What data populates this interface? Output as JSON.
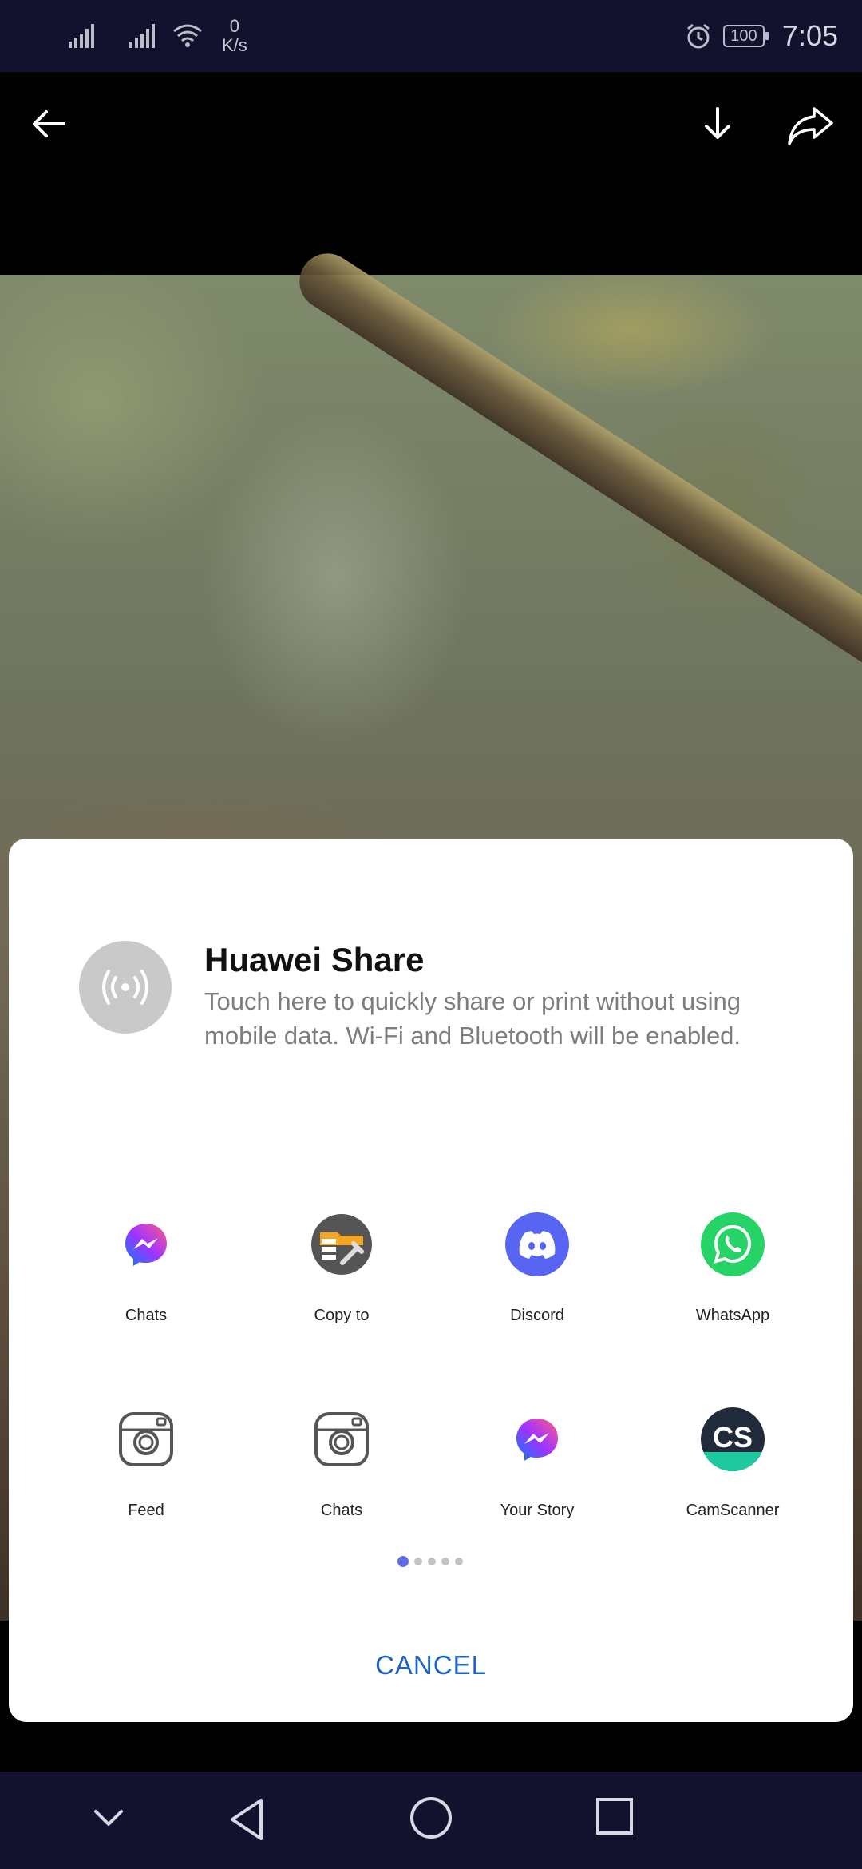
{
  "status_bar": {
    "speed_value": "0",
    "speed_unit": "K/s",
    "battery": "100",
    "time": "7:05"
  },
  "share_sheet": {
    "huawei_share": {
      "title": "Huawei Share",
      "description": "Touch here to quickly share or print without using mobile data. Wi-Fi and Bluetooth will be enabled."
    },
    "apps": [
      {
        "label": "Chats",
        "icon": "messenger-icon"
      },
      {
        "label": "Copy to",
        "icon": "copy-to-icon"
      },
      {
        "label": "Discord",
        "icon": "discord-icon"
      },
      {
        "label": "WhatsApp",
        "icon": "whatsapp-icon"
      },
      {
        "label": "Feed",
        "icon": "instagram-icon"
      },
      {
        "label": "Chats",
        "icon": "instagram-icon"
      },
      {
        "label": "Your Story",
        "icon": "messenger-icon"
      },
      {
        "label": "CamScanner",
        "icon": "camscanner-icon"
      }
    ],
    "page_count": 5,
    "current_page": 1,
    "cancel_label": "CANCEL"
  },
  "colors": {
    "accent": "#1e63c6",
    "page_dot_active": "#5f6ee0",
    "status_bar_bg": "#13122e",
    "discord": "#5865f2",
    "whatsapp": "#25d366"
  }
}
